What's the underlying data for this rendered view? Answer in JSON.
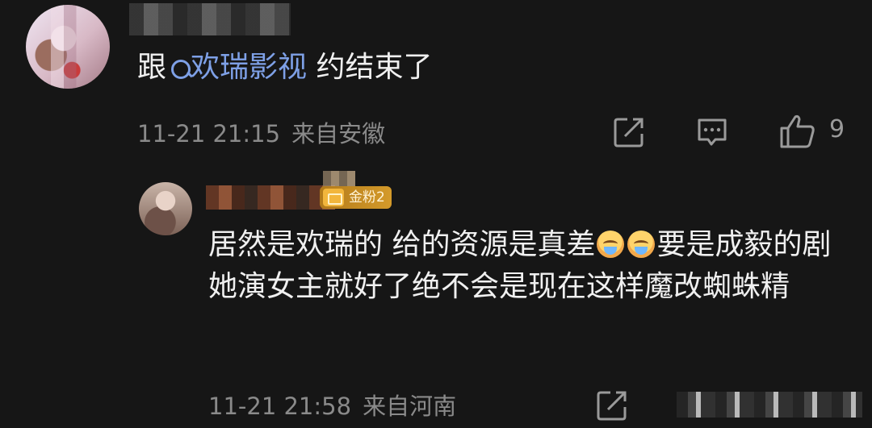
{
  "comment": {
    "prefix": "跟",
    "link_text": "欢瑞影视",
    "suffix": " 约结束了",
    "time": "11-21 21:15",
    "location": "来自安徽",
    "likes": "9"
  },
  "reply": {
    "badge_label": "金粉2",
    "text_part1": "居然是欢瑞的 给的资源是真差",
    "text_part2": "要是成毅的剧她演女主就好了绝不会是现在这样魔改蜘蛛精",
    "time": "11-21 21:58",
    "location": "来自河南"
  },
  "icons": {
    "search": "search-icon",
    "share": "share-icon",
    "reply": "comment-icon",
    "like": "thumbs-up-icon",
    "emoji": "crying-face-emoji",
    "fan_badge": "fan-badge-icon"
  },
  "colors": {
    "background": "#161616",
    "link": "#7ea0e6",
    "text": "#f0f0f0",
    "meta": "#8a8a8a",
    "badge": "#d49a2a"
  }
}
